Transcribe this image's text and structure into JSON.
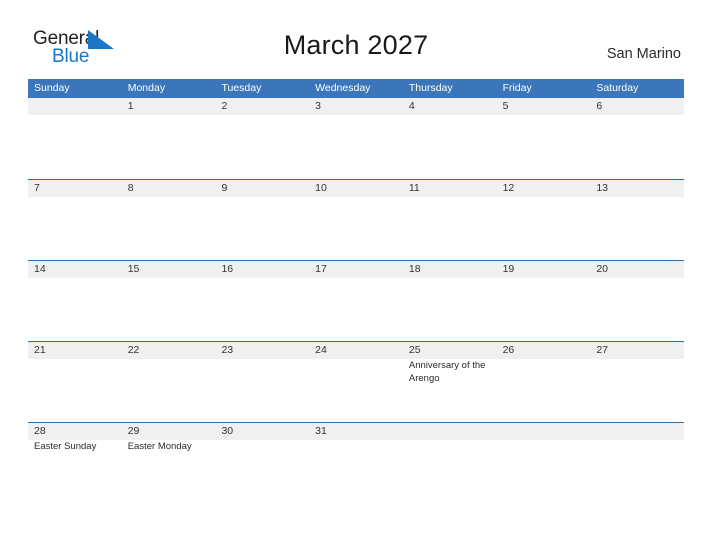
{
  "brand": {
    "word_one": "General",
    "word_two": "Blue",
    "flag_icon": "blue-triangle-flag",
    "accent_color": "#1a77c4"
  },
  "header": {
    "title": "March 2027",
    "region": "San Marino"
  },
  "colors": {
    "header_blue": "#3b76ba",
    "row_band": "#f0f0f0",
    "row_rule": "#2f6daf",
    "text": "#333333"
  },
  "calendar": {
    "weekdays": [
      "Sunday",
      "Monday",
      "Tuesday",
      "Wednesday",
      "Thursday",
      "Friday",
      "Saturday"
    ],
    "weeks": [
      [
        {
          "day": "",
          "event": ""
        },
        {
          "day": "1",
          "event": ""
        },
        {
          "day": "2",
          "event": ""
        },
        {
          "day": "3",
          "event": ""
        },
        {
          "day": "4",
          "event": ""
        },
        {
          "day": "5",
          "event": ""
        },
        {
          "day": "6",
          "event": ""
        }
      ],
      [
        {
          "day": "7",
          "event": ""
        },
        {
          "day": "8",
          "event": ""
        },
        {
          "day": "9",
          "event": ""
        },
        {
          "day": "10",
          "event": ""
        },
        {
          "day": "11",
          "event": ""
        },
        {
          "day": "12",
          "event": ""
        },
        {
          "day": "13",
          "event": ""
        }
      ],
      [
        {
          "day": "14",
          "event": ""
        },
        {
          "day": "15",
          "event": ""
        },
        {
          "day": "16",
          "event": ""
        },
        {
          "day": "17",
          "event": ""
        },
        {
          "day": "18",
          "event": ""
        },
        {
          "day": "19",
          "event": ""
        },
        {
          "day": "20",
          "event": ""
        }
      ],
      [
        {
          "day": "21",
          "event": ""
        },
        {
          "day": "22",
          "event": ""
        },
        {
          "day": "23",
          "event": ""
        },
        {
          "day": "24",
          "event": ""
        },
        {
          "day": "25",
          "event": "Anniversary of the Arengo"
        },
        {
          "day": "26",
          "event": ""
        },
        {
          "day": "27",
          "event": ""
        }
      ],
      [
        {
          "day": "28",
          "event": "Easter Sunday"
        },
        {
          "day": "29",
          "event": "Easter Monday"
        },
        {
          "day": "30",
          "event": ""
        },
        {
          "day": "31",
          "event": ""
        },
        {
          "day": "",
          "event": ""
        },
        {
          "day": "",
          "event": ""
        },
        {
          "day": "",
          "event": ""
        }
      ]
    ]
  }
}
